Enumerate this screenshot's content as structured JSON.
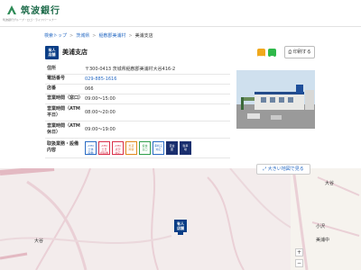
{
  "header": {
    "bank_name": "筑波銀行",
    "tagline": "筑波銀行グループ・ロゴ・ライフパートナー"
  },
  "breadcrumb": [
    {
      "label": "検索トップ",
      "link": true
    },
    {
      "label": "茨城県",
      "link": true
    },
    {
      "label": "稲敷郡美浦村",
      "link": true
    },
    {
      "label": "美浦支店",
      "link": false
    }
  ],
  "breadcrumb_sep": ">",
  "branch": {
    "badge_line1": "有人",
    "badge_line2": "店舗",
    "title": "美浦支店",
    "print_label": "印刷する"
  },
  "info_rows": [
    {
      "key": "住所",
      "value": "〒300-0413 茨城県稲敷郡美浦村大谷416-2"
    },
    {
      "key": "電話番号",
      "value": "029-885-1616",
      "link": true
    },
    {
      "key": "店番",
      "value": "066"
    },
    {
      "key": "営業時間（窓口）",
      "value": "09:00～15:00"
    },
    {
      "key": "営業時間（ATM平日）",
      "value": "08:00～20:00"
    },
    {
      "key": "営業時間（ATM休日）",
      "value": "09:00～19:00"
    }
  ],
  "services_key": "取扱業務・設備内容",
  "services": [
    {
      "line1": "ATM",
      "line2": "土休",
      "line3": "稼働",
      "color": "#2a6cc4"
    },
    {
      "line1": "ATM",
      "line2": "土日",
      "line3": "祝稼働",
      "color": "#d9304a"
    },
    {
      "line1": "ATM",
      "line2": "点字",
      "line3": "対応",
      "color": "#d9304a"
    },
    {
      "line1": "外貨",
      "line2": "両替",
      "line3": "",
      "color": "#e08a1c"
    },
    {
      "line1": "投信",
      "line2": "窓口",
      "line3": "",
      "color": "#2f9e4a"
    },
    {
      "line1": "車椅子",
      "line2": "対応",
      "line3": "",
      "color": "#2a6cc4"
    },
    {
      "line1": "貸金",
      "line2": "庫",
      "line3": "",
      "color": "#1a2f6e",
      "filled": true
    },
    {
      "line1": "駐車",
      "line2": "場",
      "line3": "",
      "color": "#1a2f6e",
      "filled": true
    }
  ],
  "map": {
    "big_map_label": "大きい地図で見る",
    "pin_line1": "有人",
    "pin_line2": "店舗",
    "places": [
      "大谷",
      "大谷",
      "小沢",
      "美浦中"
    ],
    "zoom_in": "+",
    "zoom_out": "−"
  }
}
